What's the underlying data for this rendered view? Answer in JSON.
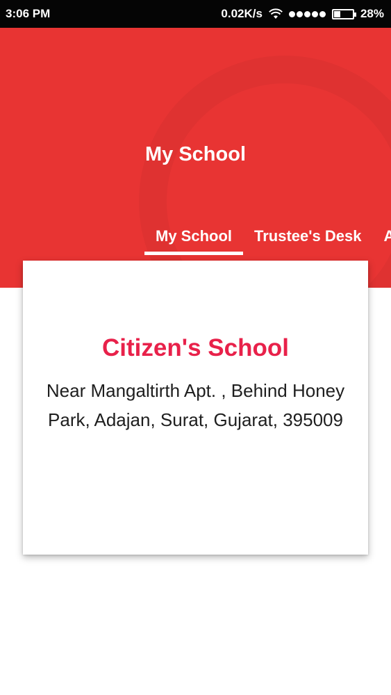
{
  "status_bar": {
    "time": "3:06 PM",
    "network_speed": "0.02K/s",
    "battery_percent": "28%",
    "icons": [
      "wifi-icon",
      "signal-icon",
      "battery-icon"
    ]
  },
  "header": {
    "title": "My School",
    "background_color": "#e83433"
  },
  "tabs": [
    {
      "label": "My School",
      "active": true
    },
    {
      "label": "Trustee's Desk",
      "active": false
    },
    {
      "label": "A",
      "active": false
    }
  ],
  "card": {
    "school_name": "Citizen's School",
    "address": "Near Mangaltirth Apt. , Behind Honey Park, Adajan, Surat, Gujarat, 395009",
    "name_color": "#e8214a"
  }
}
